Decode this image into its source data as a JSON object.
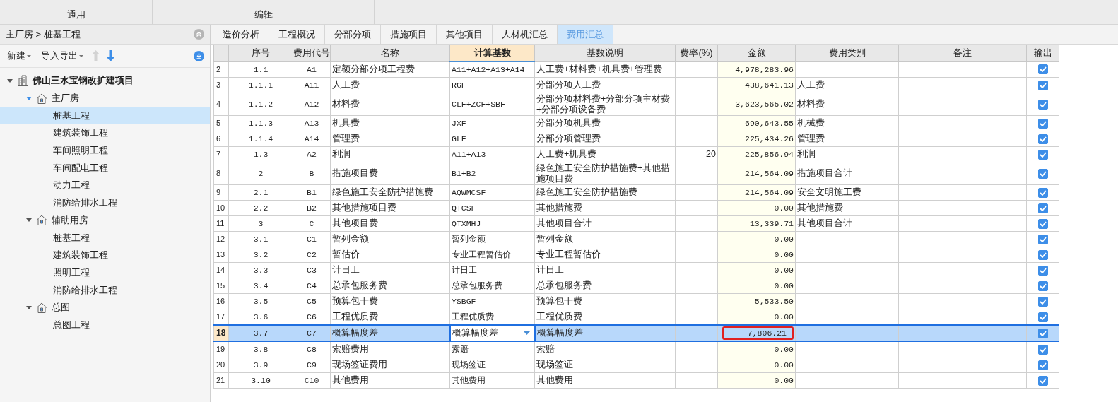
{
  "ribbon": {
    "groups": [
      "通用",
      "编辑"
    ]
  },
  "sidebar": {
    "breadcrumb": "主厂房 > 桩基工程",
    "toolbar": {
      "new": "新建",
      "import_export": "导入导出"
    },
    "tree": {
      "name": "佛山三水宝钢改扩建项目",
      "expanded": true,
      "children": [
        {
          "name": "主厂房",
          "expanded": true,
          "selected": false,
          "children": [
            {
              "name": "桩基工程",
              "selected": true
            },
            {
              "name": "建筑装饰工程",
              "selected": false
            },
            {
              "name": "车间照明工程",
              "selected": false
            },
            {
              "name": "车间配电工程",
              "selected": false
            },
            {
              "name": "动力工程",
              "selected": false
            },
            {
              "name": "消防给排水工程",
              "selected": false
            }
          ]
        },
        {
          "name": "辅助用房",
          "expanded": true,
          "selected": false,
          "children": [
            {
              "name": "桩基工程",
              "selected": false
            },
            {
              "name": "建筑装饰工程",
              "selected": false
            },
            {
              "name": "照明工程",
              "selected": false
            },
            {
              "name": "消防给排水工程",
              "selected": false
            }
          ]
        },
        {
          "name": "总图",
          "expanded": true,
          "selected": false,
          "children": [
            {
              "name": "总图工程",
              "selected": false
            }
          ]
        }
      ]
    }
  },
  "tabs": [
    {
      "label": "造价分析",
      "selected": false
    },
    {
      "label": "工程概况",
      "selected": false
    },
    {
      "label": "分部分项",
      "selected": false
    },
    {
      "label": "措施项目",
      "selected": false
    },
    {
      "label": "其他项目",
      "selected": false
    },
    {
      "label": "人材机汇总",
      "selected": false
    },
    {
      "label": "费用汇总",
      "selected": true
    }
  ],
  "table": {
    "columns": [
      {
        "label": "序号",
        "selected": false
      },
      {
        "label": "费用代号",
        "selected": false
      },
      {
        "label": "名称",
        "selected": false
      },
      {
        "label": "计算基数",
        "selected": true
      },
      {
        "label": "基数说明",
        "selected": false
      },
      {
        "label": "费率(%)",
        "selected": false
      },
      {
        "label": "金额",
        "selected": false
      },
      {
        "label": "费用类别",
        "selected": false
      },
      {
        "label": "备注",
        "selected": false
      },
      {
        "label": "输出",
        "selected": false
      }
    ],
    "rows": [
      {
        "no": "2",
        "seq": "1.1",
        "code": "A1",
        "name": "定额分部分项工程费",
        "base": "A11+A12+A13+A14",
        "desc": "人工费+材料费+机具费+管理费",
        "amount": "4,978,283.96",
        "output": true,
        "selected": false,
        "flagged": false
      },
      {
        "no": "3",
        "seq": "1.1.1",
        "code": "A11",
        "name": "人工费",
        "base": "RGF",
        "desc": "分部分项人工费",
        "amount": "438,641.13",
        "category": "人工费",
        "output": true,
        "selected": false,
        "flagged": false
      },
      {
        "no": "4",
        "seq": "1.1.2",
        "code": "A12",
        "name": "材料费",
        "base": "CLF+ZCF+SBF",
        "desc": "分部分项材料费+分部分项主材费+分部分项设备费",
        "amount": "3,623,565.02",
        "category": "材料费",
        "output": true,
        "selected": false,
        "flagged": false
      },
      {
        "no": "5",
        "seq": "1.1.3",
        "code": "A13",
        "name": "机具费",
        "base": "JXF",
        "desc": "分部分项机具费",
        "amount": "690,643.55",
        "category": "机械费",
        "output": true,
        "selected": false,
        "flagged": false
      },
      {
        "no": "6",
        "seq": "1.1.4",
        "code": "A14",
        "name": "管理费",
        "base": "GLF",
        "desc": "分部分项管理费",
        "amount": "225,434.26",
        "category": "管理费",
        "output": true,
        "selected": false,
        "flagged": false
      },
      {
        "no": "7",
        "seq": "1.3",
        "code": "A2",
        "name": "利润",
        "base": "A11+A13",
        "desc": "人工费+机具费",
        "rate": "20",
        "amount": "225,856.94",
        "category": "利润",
        "output": true,
        "selected": false,
        "flagged": false
      },
      {
        "no": "8",
        "seq": "2",
        "code": "B",
        "name": "措施项目费",
        "base": "B1+B2",
        "desc": "绿色施工安全防护措施费+其他措施项目费",
        "amount": "214,564.09",
        "category": "措施项目合计",
        "output": true,
        "selected": false,
        "flagged": false
      },
      {
        "no": "9",
        "seq": "2.1",
        "code": "B1",
        "name": "绿色施工安全防护措施费",
        "base": "AQWMCSF",
        "desc": "绿色施工安全防护措施费",
        "amount": "214,564.09",
        "category": "安全文明施工费",
        "output": true,
        "selected": false,
        "flagged": false
      },
      {
        "no": "10",
        "seq": "2.2",
        "code": "B2",
        "name": "其他措施项目费",
        "base": "QTCSF",
        "desc": "其他措施费",
        "amount": "0.00",
        "category": "其他措施费",
        "output": true,
        "selected": false,
        "flagged": false
      },
      {
        "no": "11",
        "seq": "3",
        "code": "C",
        "name": "其他项目费",
        "base": "QTXMHJ",
        "desc": "其他项目合计",
        "amount": "13,339.71",
        "category": "其他项目合计",
        "output": true,
        "selected": false,
        "flagged": false
      },
      {
        "no": "12",
        "seq": "3.1",
        "code": "C1",
        "name": "暂列金额",
        "base": "暂列金额",
        "desc": "暂列金额",
        "amount": "0.00",
        "output": true,
        "selected": false,
        "flagged": false
      },
      {
        "no": "13",
        "seq": "3.2",
        "code": "C2",
        "name": "暂估价",
        "base": "专业工程暂估价",
        "desc": "专业工程暂估价",
        "amount": "0.00",
        "output": true,
        "selected": false,
        "flagged": false
      },
      {
        "no": "14",
        "seq": "3.3",
        "code": "C3",
        "name": "计日工",
        "base": "计日工",
        "desc": "计日工",
        "amount": "0.00",
        "output": true,
        "selected": false,
        "flagged": false
      },
      {
        "no": "15",
        "seq": "3.4",
        "code": "C4",
        "name": "总承包服务费",
        "base": "总承包服务费",
        "desc": "总承包服务费",
        "amount": "0.00",
        "output": true,
        "selected": false,
        "flagged": false
      },
      {
        "no": "16",
        "seq": "3.5",
        "code": "C5",
        "name": "预算包干费",
        "base": "YSBGF",
        "desc": "预算包干费",
        "amount": "5,533.50",
        "output": true,
        "selected": false,
        "flagged": false
      },
      {
        "no": "17",
        "seq": "3.6",
        "code": "C6",
        "name": "工程优质费",
        "base": "工程优质费",
        "desc": "工程优质费",
        "amount": "0.00",
        "output": true,
        "selected": false,
        "flagged": false
      },
      {
        "no": "18",
        "seq": "3.7",
        "code": "C7",
        "name": "概算幅度差",
        "base": "概算幅度差",
        "desc": "概算幅度差",
        "amount": "7,806.21",
        "output": true,
        "selected": true,
        "flagged": true
      },
      {
        "no": "19",
        "seq": "3.8",
        "code": "C8",
        "name": "索赔费用",
        "base": "索赔",
        "desc": "索赔",
        "amount": "0.00",
        "output": true,
        "selected": false,
        "flagged": false
      },
      {
        "no": "20",
        "seq": "3.9",
        "code": "C9",
        "name": "现场签证费用",
        "base": "现场签证",
        "desc": "现场签证",
        "amount": "0.00",
        "output": true,
        "selected": false,
        "flagged": false
      },
      {
        "no": "21",
        "seq": "3.10",
        "code": "C10",
        "name": "其他费用",
        "base": "其他费用",
        "desc": "其他费用",
        "amount": "0.00",
        "output": true,
        "selected": false,
        "flagged": false
      }
    ]
  }
}
